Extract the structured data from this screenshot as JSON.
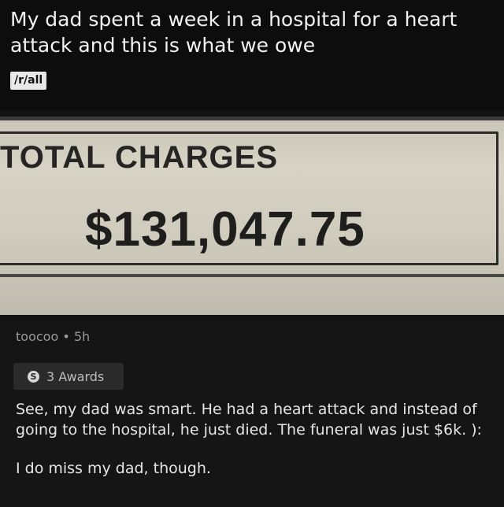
{
  "post": {
    "title": "My dad spent a week in a hospital for a heart attack and this is what we owe",
    "subreddit": "/r/all"
  },
  "image": {
    "label": "TOTAL CHARGES",
    "amount": "$131,047.75"
  },
  "comment": {
    "author": "toocoo",
    "separator": "•",
    "age": "5h",
    "awards": {
      "icon": "award-icon",
      "label": "3 Awards"
    },
    "paragraphs": [
      "See, my dad was smart. He had a heart attack and instead of going to the hospital, he just died. The funeral was just $6k. ):",
      "I do miss my dad, though."
    ]
  },
  "colors": {
    "background": "#151515",
    "header_background": "#0d0d0d",
    "text": "#ececec",
    "muted": "#9a9a9a",
    "award_chip": "#2a2a2a"
  }
}
